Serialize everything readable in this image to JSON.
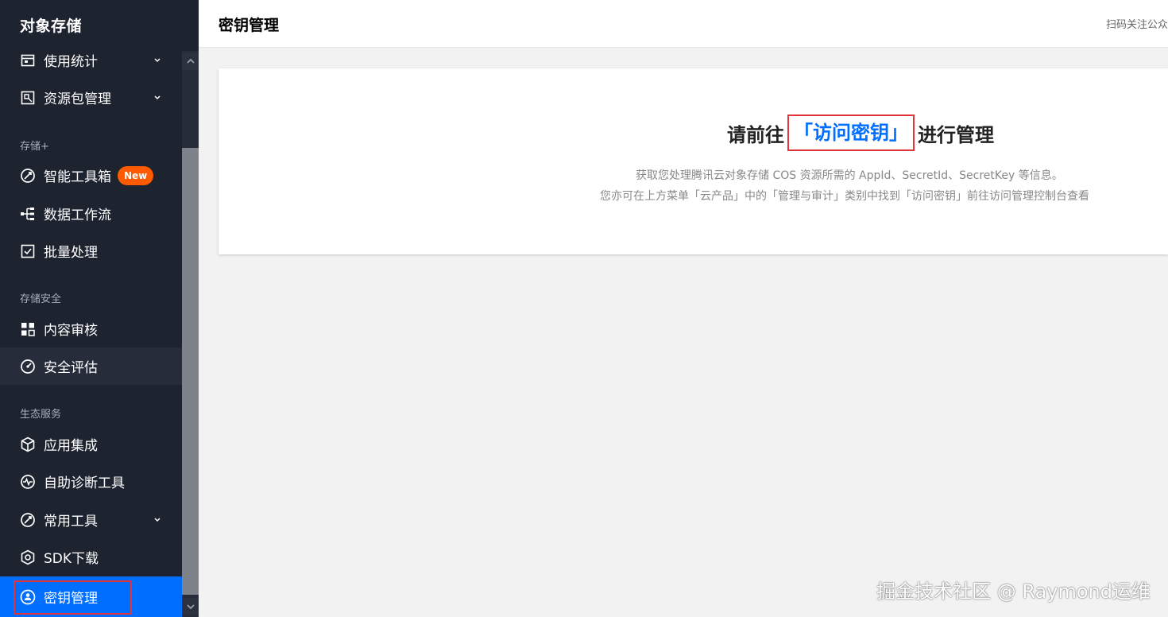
{
  "sidebar": {
    "title": "对象存储",
    "items": {
      "usage": "使用统计",
      "package": "资源包管理",
      "toolbox": "智能工具箱",
      "toolbox_badge": "New",
      "workflow": "数据工作流",
      "batch": "批量处理",
      "moderation": "内容审核",
      "security_eval": "安全评估",
      "app_integration": "应用集成",
      "diagnosis": "自助诊断工具",
      "common_tools": "常用工具",
      "sdk": "SDK下载",
      "key_mgmt": "密钥管理"
    },
    "sections": {
      "storage_plus": "存储+",
      "storage_security": "存储安全",
      "ecosystem": "生态服务"
    }
  },
  "header": {
    "title": "密钥管理",
    "right_text": "扫码关注公众"
  },
  "main": {
    "headline_prefix": "请前往",
    "headline_link": "「访问密钥」",
    "headline_suffix": "进行管理",
    "desc_line1": "获取您处理腾讯云对象存储 COS 资源所需的 AppId、SecretId、SecretKey 等信息。",
    "desc_line2": "您亦可在上方菜单「云产品」中的「管理与审计」类别中找到「访问密钥」前往访问管理控制台查看"
  },
  "watermark": "掘金技术社区 @ Raymond运维",
  "colors": {
    "sidebar_bg": "#1e2330",
    "active_bg": "#006eff",
    "accent_link": "#006eff",
    "badge": "#ff5a00",
    "highlight_frame": "#e0343a"
  }
}
